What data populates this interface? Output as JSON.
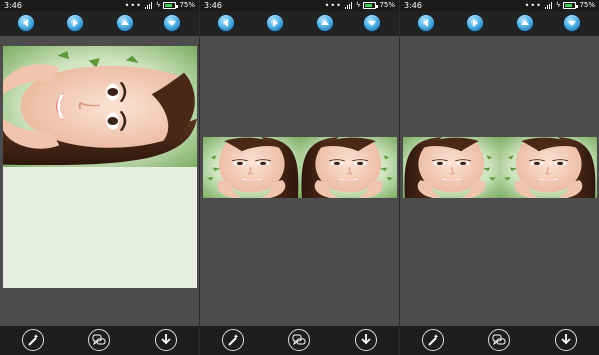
{
  "panels": [
    {
      "status": {
        "time": "3:46",
        "battery": "75%"
      }
    },
    {
      "status": {
        "time": "3:46",
        "battery": "75%"
      }
    },
    {
      "status": {
        "time": "3:46",
        "battery": "75%"
      }
    }
  ],
  "colors": {
    "background": "#4c4c4c",
    "toolbar": "#222222",
    "accent": "#4fb1e8",
    "battery_fill": "#3cd25a"
  },
  "icons": {
    "top": [
      "arrow-left-icon",
      "arrow-right-icon",
      "arrow-up-icon",
      "arrow-down-icon"
    ],
    "bottom": [
      "magic-wand-icon",
      "chat-bubbles-icon",
      "download-icon"
    ]
  }
}
